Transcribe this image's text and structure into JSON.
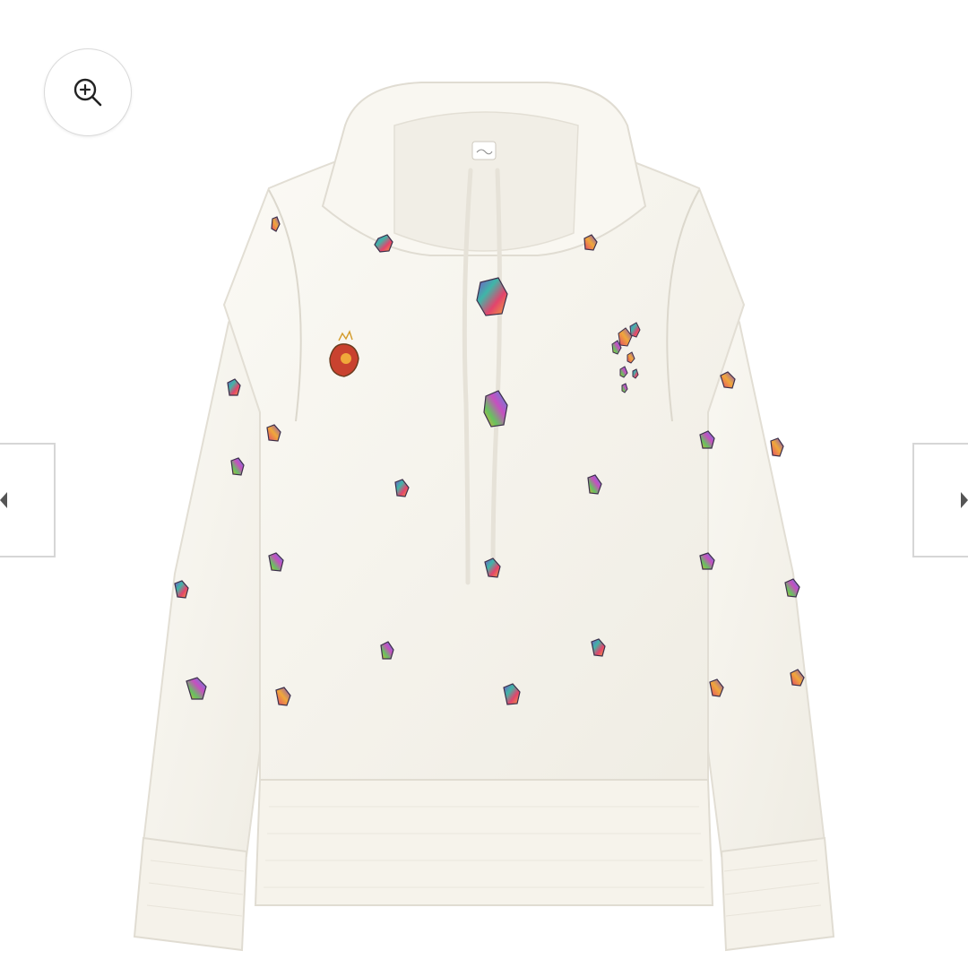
{
  "product": {
    "image_description_name": "product-photo",
    "colors": {
      "garment": "#f7f5ef",
      "garment_shadow": "#e4e0d6",
      "seam": "#dcd8cd",
      "drawcord": "#f2efe8"
    }
  },
  "gallery": {
    "zoom_icon": "zoom-in-icon",
    "prev_icon": "chevron-left-icon",
    "next_icon": "chevron-right-icon",
    "arrow_color": "#555555",
    "border_color": "#d6d6d6"
  },
  "embroidery": {
    "gem_palette": [
      "#7b4fc9",
      "#3fb6a8",
      "#e3446c",
      "#f0a83a",
      "#4a8fe0",
      "#67c25e",
      "#c64fc0"
    ]
  }
}
